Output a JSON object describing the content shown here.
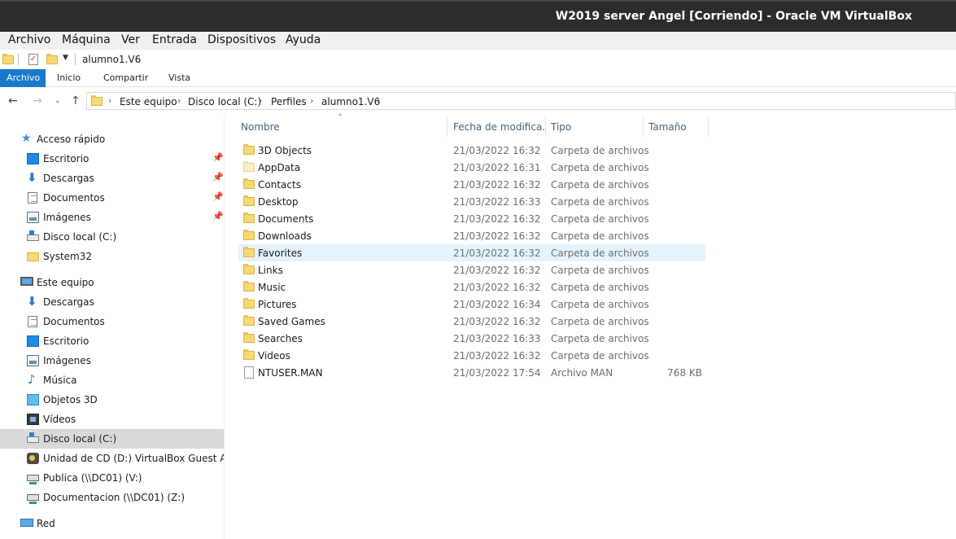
{
  "window": {
    "title": "W2019 server Angel [Corriendo] - Oracle VM VirtualBox"
  },
  "vbox_menu": [
    "Archivo",
    "Máquina",
    "Ver",
    "Entrada",
    "Dispositivos",
    "Ayuda"
  ],
  "quick_access_toolbar": {
    "path_title": "alumno1.V6",
    "icons": [
      "folder-icon",
      "properties-icon",
      "new-folder-icon",
      "customize-dropdown-icon"
    ]
  },
  "ribbon": {
    "active_tab": "Archivo",
    "tabs": [
      "Inicio",
      "Compartir",
      "Vista"
    ],
    "accent_color": "#1979ca"
  },
  "address_bar": {
    "breadcrumbs": [
      "Este equipo",
      "Disco local (C:)",
      "Perfiles",
      "alumno1.V6"
    ]
  },
  "nav_pane": {
    "quick_access": {
      "label": "Acceso rápido",
      "items": [
        {
          "label": "Escritorio",
          "icon": "desktop-icon",
          "pinned": true
        },
        {
          "label": "Descargas",
          "icon": "download-icon",
          "pinned": true
        },
        {
          "label": "Documentos",
          "icon": "document-icon",
          "pinned": true
        },
        {
          "label": "Imágenes",
          "icon": "image-icon",
          "pinned": true
        },
        {
          "label": "Disco local (C:)",
          "icon": "drive-icon",
          "pinned": false
        },
        {
          "label": "System32",
          "icon": "folder-icon",
          "pinned": false
        }
      ]
    },
    "this_pc": {
      "label": "Este equipo",
      "items": [
        {
          "label": "Descargas",
          "icon": "download-icon"
        },
        {
          "label": "Documentos",
          "icon": "document-icon"
        },
        {
          "label": "Escritorio",
          "icon": "desktop-icon"
        },
        {
          "label": "Imágenes",
          "icon": "image-icon"
        },
        {
          "label": "Música",
          "icon": "music-icon"
        },
        {
          "label": "Objetos 3D",
          "icon": "3d-objects-icon"
        },
        {
          "label": "Vídeos",
          "icon": "video-icon"
        },
        {
          "label": "Disco local (C:)",
          "icon": "drive-icon",
          "selected": true
        },
        {
          "label": "Unidad de CD (D:) VirtualBox Guest Additio",
          "icon": "cd-drive-icon"
        },
        {
          "label": "Publica (\\\\DC01) (V:)",
          "icon": "network-drive-icon"
        },
        {
          "label": "Documentacion (\\\\DC01) (Z:)",
          "icon": "network-drive-icon"
        }
      ]
    },
    "network": {
      "label": "Red",
      "icon": "network-icon"
    }
  },
  "file_list": {
    "columns": {
      "name": "Nombre",
      "date": "Fecha de modifica...",
      "type": "Tipo",
      "size": "Tamaño"
    },
    "rows": [
      {
        "name": "3D Objects",
        "date": "21/03/2022 16:32",
        "type": "Carpeta de archivos",
        "size": "",
        "icon": "folder-icon"
      },
      {
        "name": "AppData",
        "date": "21/03/2022 16:31",
        "type": "Carpeta de archivos",
        "size": "",
        "icon": "hidden-folder-icon"
      },
      {
        "name": "Contacts",
        "date": "21/03/2022 16:32",
        "type": "Carpeta de archivos",
        "size": "",
        "icon": "folder-icon"
      },
      {
        "name": "Desktop",
        "date": "21/03/2022 16:33",
        "type": "Carpeta de archivos",
        "size": "",
        "icon": "folder-icon"
      },
      {
        "name": "Documents",
        "date": "21/03/2022 16:32",
        "type": "Carpeta de archivos",
        "size": "",
        "icon": "folder-icon"
      },
      {
        "name": "Downloads",
        "date": "21/03/2022 16:32",
        "type": "Carpeta de archivos",
        "size": "",
        "icon": "folder-icon"
      },
      {
        "name": "Favorites",
        "date": "21/03/2022 16:32",
        "type": "Carpeta de archivos",
        "size": "",
        "icon": "folder-icon",
        "hover": true
      },
      {
        "name": "Links",
        "date": "21/03/2022 16:32",
        "type": "Carpeta de archivos",
        "size": "",
        "icon": "folder-icon"
      },
      {
        "name": "Music",
        "date": "21/03/2022 16:32",
        "type": "Carpeta de archivos",
        "size": "",
        "icon": "folder-icon"
      },
      {
        "name": "Pictures",
        "date": "21/03/2022 16:34",
        "type": "Carpeta de archivos",
        "size": "",
        "icon": "folder-icon"
      },
      {
        "name": "Saved Games",
        "date": "21/03/2022 16:32",
        "type": "Carpeta de archivos",
        "size": "",
        "icon": "folder-icon"
      },
      {
        "name": "Searches",
        "date": "21/03/2022 16:33",
        "type": "Carpeta de archivos",
        "size": "",
        "icon": "folder-icon"
      },
      {
        "name": "Videos",
        "date": "21/03/2022 16:32",
        "type": "Carpeta de archivos",
        "size": "",
        "icon": "folder-icon"
      },
      {
        "name": "NTUSER.MAN",
        "date": "21/03/2022 17:54",
        "type": "Archivo MAN",
        "size": "768 KB",
        "icon": "file-icon"
      }
    ]
  }
}
